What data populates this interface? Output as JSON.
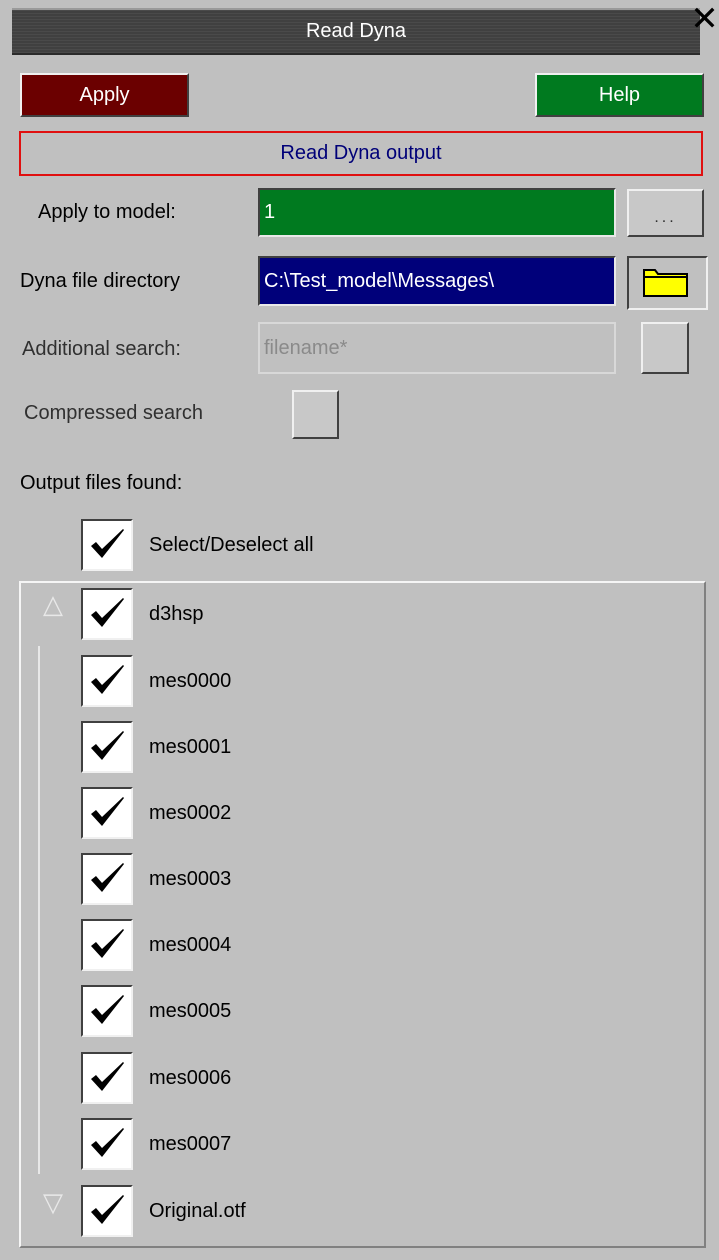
{
  "window": {
    "title": "Read Dyna",
    "close_glyph": "✕"
  },
  "toolbar": {
    "apply_label": "Apply",
    "help_label": "Help"
  },
  "mode": {
    "label": "Read Dyna output"
  },
  "form": {
    "apply_to_model_label": "Apply to model:",
    "apply_to_model_value": "1",
    "dots_label": "...",
    "dyna_dir_label": "Dyna file directory",
    "dyna_dir_value": "C:\\Test_model\\Messages\\",
    "additional_search_label": "Additional search:",
    "additional_search_placeholder": "filename*",
    "compressed_search_label": "Compressed search"
  },
  "output": {
    "heading": "Output files found:",
    "select_all_label": "Select/Deselect all",
    "select_all_checked": true,
    "files": [
      {
        "name": "d3hsp",
        "checked": true
      },
      {
        "name": "mes0000",
        "checked": true
      },
      {
        "name": "mes0001",
        "checked": true
      },
      {
        "name": "mes0002",
        "checked": true
      },
      {
        "name": "mes0003",
        "checked": true
      },
      {
        "name": "mes0004",
        "checked": true
      },
      {
        "name": "mes0005",
        "checked": true
      },
      {
        "name": "mes0006",
        "checked": true
      },
      {
        "name": "mes0007",
        "checked": true
      },
      {
        "name": "Original.otf",
        "checked": true
      }
    ]
  },
  "icons": {
    "check": "check-icon",
    "folder": "folder-icon",
    "scroll_up": "△",
    "scroll_down": "▽"
  },
  "colors": {
    "apply_bg": "#6b0000",
    "help_bg": "#007a1f",
    "model_field_bg": "#007a1f",
    "dir_field_bg": "#00007a",
    "folder_icon": "#ffff00",
    "mode_border": "#e01010"
  }
}
